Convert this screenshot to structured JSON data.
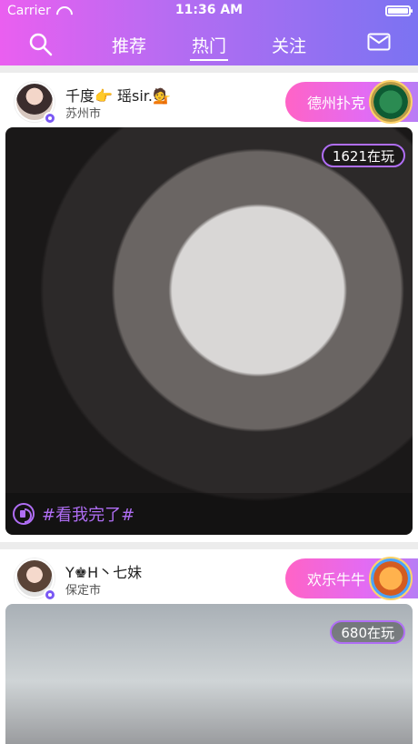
{
  "status_bar": {
    "carrier": "Carrier",
    "time": "11:36 AM",
    "wifi_icon": "wifi-icon",
    "battery_icon": "battery-icon"
  },
  "header": {
    "tabs": [
      {
        "label": "推荐",
        "active": false
      },
      {
        "label": "热门",
        "active": true
      },
      {
        "label": "关注",
        "active": false
      }
    ],
    "search_icon": "search-icon",
    "mail_icon": "mail-icon"
  },
  "cards": [
    {
      "user": {
        "name": "千度👉 瑶sir.💁",
        "city": "苏州市"
      },
      "game": {
        "label": "德州扑克"
      },
      "players": "1621在玩",
      "caption": "#看我完了#"
    },
    {
      "user": {
        "name": "Y♚H丶七妹",
        "city": "保定市"
      },
      "game": {
        "label": "欢乐牛牛"
      },
      "players": "680在玩"
    }
  ],
  "colors": {
    "header_gradient_start": "#ea5ff0",
    "header_gradient_end": "#7b73f2",
    "accent_purple": "#b06ef5"
  }
}
